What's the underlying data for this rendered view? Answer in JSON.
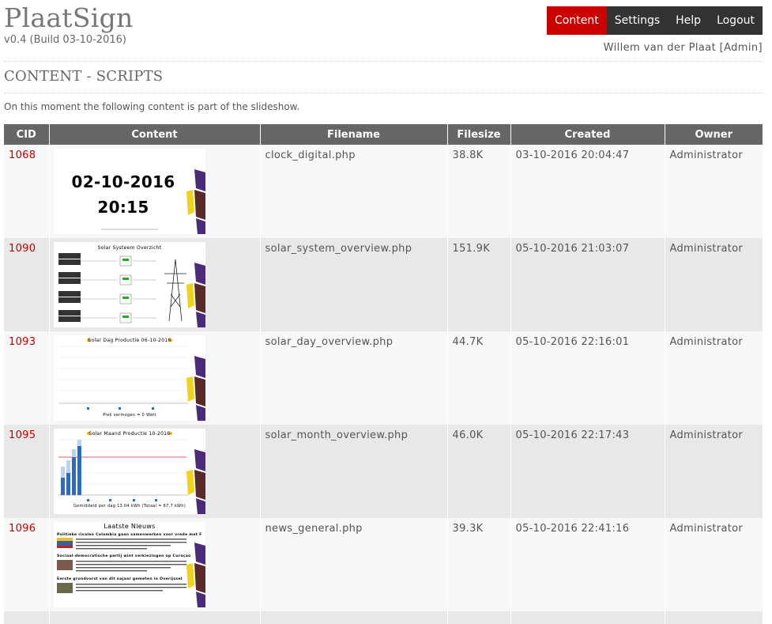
{
  "app": {
    "title": "PlaatSign",
    "version": "v0.4 (Build 03-10-2016)"
  },
  "nav": [
    {
      "label": "Content",
      "active": true
    },
    {
      "label": "Settings",
      "active": false
    },
    {
      "label": "Help",
      "active": false
    },
    {
      "label": "Logout",
      "active": false
    }
  ],
  "user": "Willem van der Plaat [Admin]",
  "page_title": "CONTENT - SCRIPTS",
  "intro": "On this moment the following content is part of the slideshow.",
  "table": {
    "headers": [
      "CID",
      "Content",
      "Filename",
      "Filesize",
      "Created",
      "Owner"
    ],
    "rows": [
      {
        "cid": "1068",
        "filename": "clock_digital.php",
        "filesize": "38.8K",
        "created": "03-10-2016 20:04:47",
        "owner": "Administrator"
      },
      {
        "cid": "1090",
        "filename": "solar_system_overview.php",
        "filesize": "151.9K",
        "created": "05-10-2016 21:03:07",
        "owner": "Administrator"
      },
      {
        "cid": "1093",
        "filename": "solar_day_overview.php",
        "filesize": "44.7K",
        "created": "05-10-2016 22:16:01",
        "owner": "Administrator"
      },
      {
        "cid": "1095",
        "filename": "solar_month_overview.php",
        "filesize": "46.0K",
        "created": "05-10-2016 22:17:43",
        "owner": "Administrator"
      },
      {
        "cid": "1096",
        "filename": "news_general.php",
        "filesize": "39.3K",
        "created": "05-10-2016 22:41:16",
        "owner": "Administrator"
      }
    ]
  },
  "thumbs": {
    "clock": {
      "date": "02-10-2016",
      "time": "20:15"
    },
    "solar_system": {
      "title": "Solar Systeem Overzicht"
    },
    "solar_day": {
      "title": "Solar Dag Productie 06-10-2016",
      "footer": "Piek vermogen = 0 Watt"
    },
    "solar_month": {
      "title": "Solar Maand Productie 10-2016",
      "footer": "Gemiddeld per dag 13.04 kWh (Totaal = 67.7 kWh)"
    },
    "news": {
      "title": "Laatste Nieuws",
      "headlines": [
        "Politieke rivalen Colombia gaan samenwerken voor vrede met F",
        "Sociaal-democratische partij wint verkiezingen op Curaçao",
        "Eerste grondvorst van dit najaar gemeten in Overijssel"
      ]
    }
  },
  "colors": {
    "nav_bg": "#333333",
    "nav_active": "#cc0000",
    "header_bg": "#666666",
    "cid_link": "#c00000",
    "row_odd": "#f7f7f7",
    "row_even": "#e8e8e8",
    "deco_purple": "#4b2a7a",
    "deco_yellow": "#f1d21a",
    "deco_brown": "#5a2a2a"
  }
}
